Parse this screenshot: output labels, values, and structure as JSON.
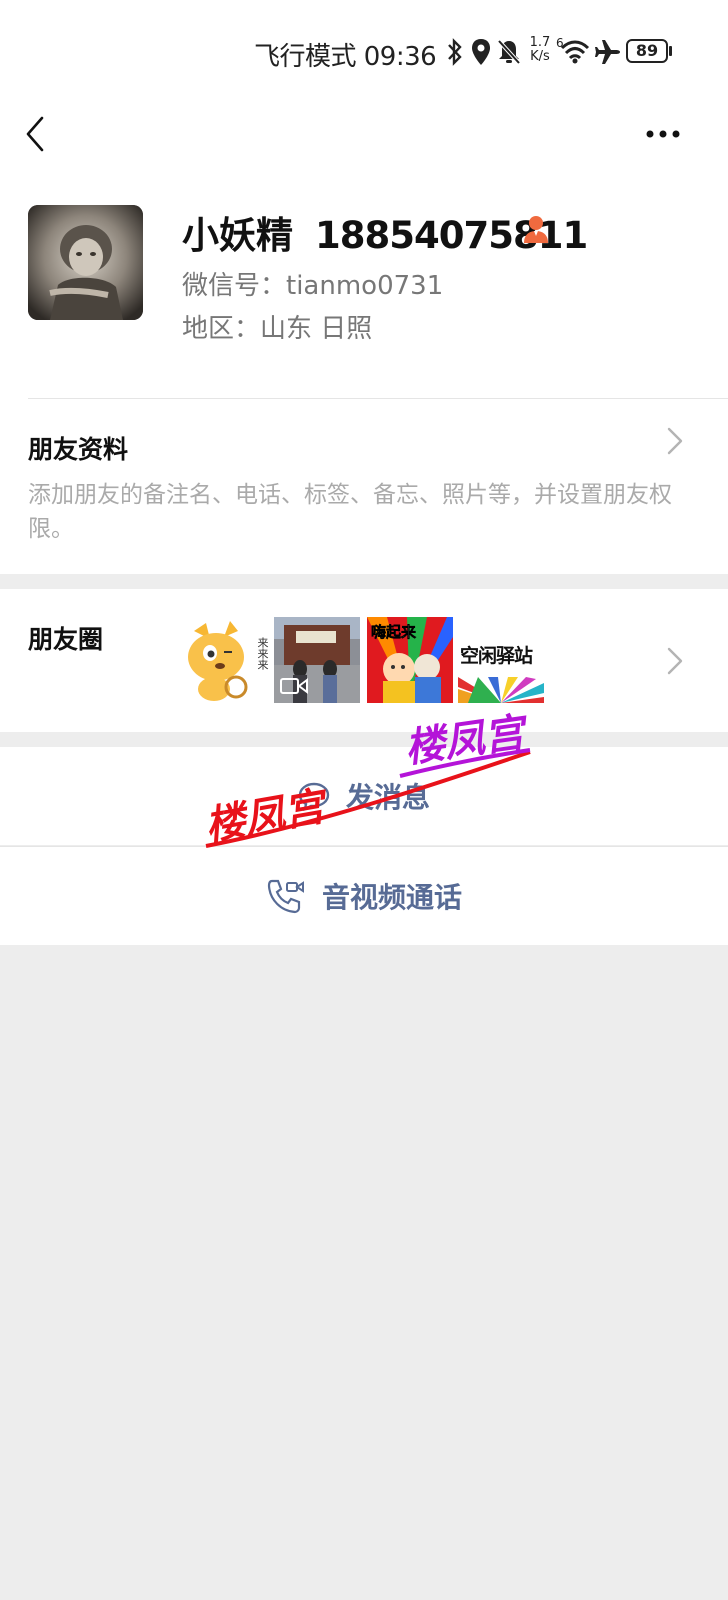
{
  "status_bar": {
    "mode_time": "飞行模式 09:36",
    "net_speed_top": "1.7",
    "net_speed_bottom": "K/s",
    "network_mark": "6",
    "battery": "89"
  },
  "nav": {
    "back_icon": "chevron-left-icon",
    "more_icon": "more-dots-icon"
  },
  "profile": {
    "name": "小妖精",
    "phone": "18854075811",
    "wechat_id": "微信号：tianmo0731",
    "region": "地区：山东  日照"
  },
  "friend_info": {
    "title": "朋友资料",
    "description": "添加朋友的备注名、电话、标签、备忘、照片等，并设置朋友权限。"
  },
  "moments": {
    "title": "朋友圈",
    "thumb_texts": [
      "来来来",
      "嗨起来",
      "空闲驿站"
    ]
  },
  "actions": {
    "send_message": "发消息",
    "av_call": "音视频通话"
  },
  "watermark": {
    "text": "楼凤宫",
    "color_red": "#e8121a",
    "color_purple": "#b414d8"
  },
  "colors": {
    "link": "#576b95",
    "background": "#ededed",
    "contact_icon": "#f06a3f"
  }
}
